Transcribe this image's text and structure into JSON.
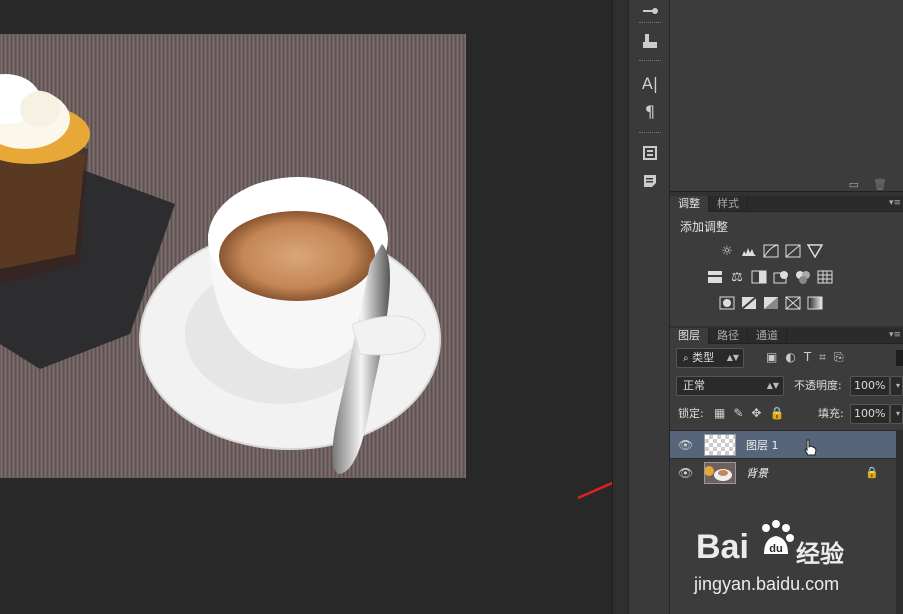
{
  "icons": {
    "mini_toolbar": [
      "brush-preset-icon",
      "clone-source-icon",
      "character-icon",
      "paragraph-icon",
      "character-styles-icon",
      "paragraph-styles-icon"
    ],
    "adjustments_row1": [
      "brightness-icon",
      "levels-icon",
      "curves-icon",
      "exposure-icon",
      "vibrance-icon"
    ],
    "adjustments_row2": [
      "hue-saturation-icon",
      "color-balance-icon",
      "black-white-icon",
      "photo-filter-icon",
      "channel-mixer-icon",
      "color-lookup-icon"
    ],
    "adjustments_row3": [
      "invert-icon",
      "posterize-icon",
      "threshold-icon",
      "selective-color-icon",
      "gradient-map-icon"
    ],
    "layer_filters": [
      "pixel-filter-icon",
      "adjustment-filter-icon",
      "type-filter-icon",
      "shape-filter-icon",
      "smart-object-filter-icon"
    ],
    "lock_options": [
      "lock-transparent-icon",
      "lock-pixels-icon",
      "lock-position-icon",
      "lock-all-icon"
    ]
  },
  "adjustments_panel": {
    "tabs": [
      "调整",
      "样式"
    ],
    "title": "添加调整"
  },
  "layers_panel": {
    "tabs": [
      "图层",
      "路径",
      "通道"
    ],
    "filter_type": "类型",
    "blend_mode": "正常",
    "opacity_label": "不透明度:",
    "opacity_value": "100%",
    "lock_label": "锁定:",
    "fill_label": "填充:",
    "fill_value": "100%",
    "layers": [
      {
        "name": "图层 1",
        "selected": true,
        "visible": true,
        "locked": false
      },
      {
        "name": "背景",
        "selected": false,
        "visible": true,
        "locked": true
      }
    ]
  },
  "watermark": {
    "brand": "Bai",
    "brand_suffix": "经验",
    "url": "jingyan.baidu.com"
  },
  "colors": {
    "selected_layer": "#56657a",
    "annotation_arrow": "#e02020",
    "panel_bg": "#3c3c3c"
  }
}
